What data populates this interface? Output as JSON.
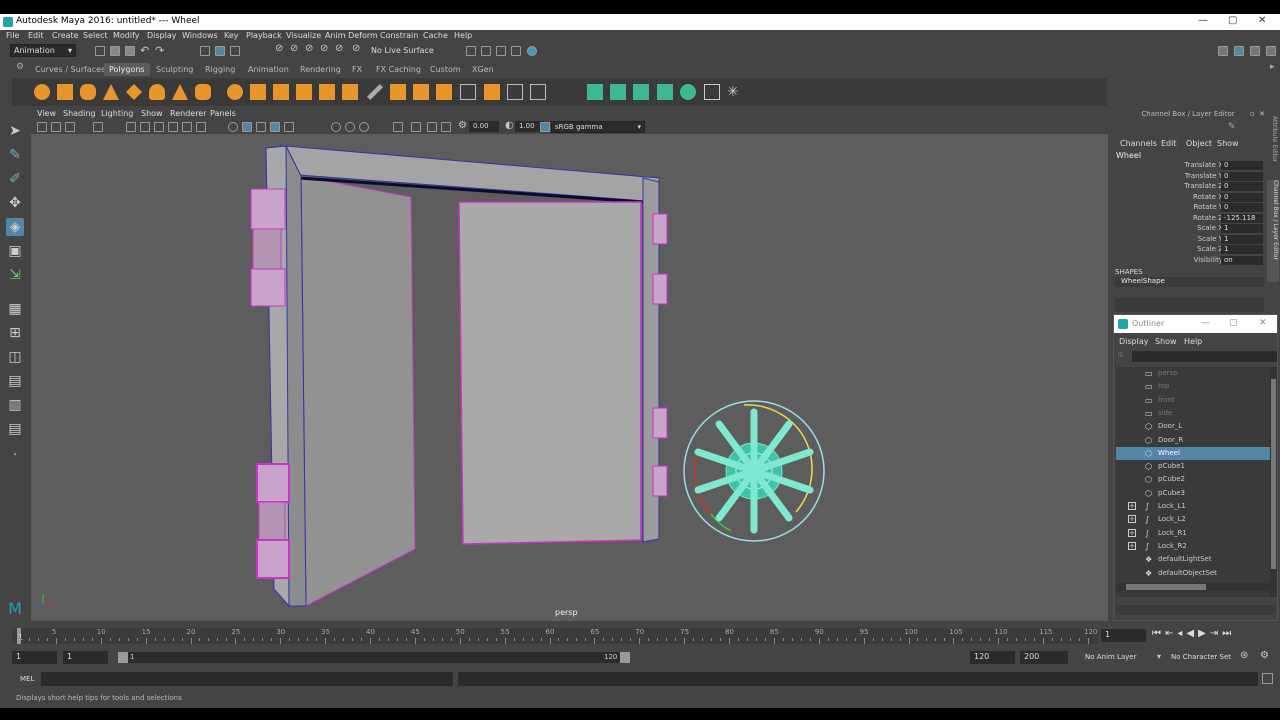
{
  "window": {
    "title": "Autodesk Maya 2016: untitled*  ---  Wheel"
  },
  "menubar": [
    "File",
    "Edit",
    "Create",
    "Select",
    "Modify",
    "Display",
    "Windows",
    "Key",
    "Playback",
    "Visualize",
    "Anim Deform",
    "Constrain",
    "Cache",
    "Help"
  ],
  "statusline": {
    "mode": "Animation",
    "live_surface": "No Live Surface"
  },
  "shelf_tabs": [
    "Curves / Surfaces",
    "Polygons",
    "Sculpting",
    "Rigging",
    "Animation",
    "Rendering",
    "FX",
    "FX Caching",
    "Custom",
    "XGen"
  ],
  "shelf_active": "Polygons",
  "viewport": {
    "menu": [
      "View",
      "Shading",
      "Lighting",
      "Show",
      "Renderer",
      "Panels"
    ],
    "exposure": "0.00",
    "gamma": "1.00",
    "color_space": "sRGB gamma",
    "camera_label": "persp"
  },
  "channel_box": {
    "header": "Channel Box / Layer Editor",
    "menu": [
      "Channels",
      "Edit",
      "Object",
      "Show"
    ],
    "object": "Wheel",
    "attributes": [
      {
        "name": "Translate X",
        "value": "0"
      },
      {
        "name": "Translate Y",
        "value": "0"
      },
      {
        "name": "Translate Z",
        "value": "0"
      },
      {
        "name": "Rotate X",
        "value": "0"
      },
      {
        "name": "Rotate Y",
        "value": "0"
      },
      {
        "name": "Rotate Z",
        "value": "-125.118"
      },
      {
        "name": "Scale X",
        "value": "1"
      },
      {
        "name": "Scale Y",
        "value": "1"
      },
      {
        "name": "Scale Z",
        "value": "1"
      },
      {
        "name": "Visibility",
        "value": "on"
      }
    ],
    "shapes_label": "SHAPES",
    "shape_name": "WheelShape"
  },
  "side_tabs": {
    "attribute_editor": "Attribute Editor",
    "channel_box": "Channel Box / Layer Editor"
  },
  "outliner": {
    "title": "Outliner",
    "menu": [
      "Display",
      "Show",
      "Help"
    ],
    "items": [
      {
        "label": "persp",
        "icon": "camera-icon",
        "dim": true
      },
      {
        "label": "top",
        "icon": "camera-icon",
        "dim": true
      },
      {
        "label": "front",
        "icon": "camera-icon",
        "dim": true
      },
      {
        "label": "side",
        "icon": "camera-icon",
        "dim": true
      },
      {
        "label": "Door_L",
        "icon": "mesh-icon"
      },
      {
        "label": "Door_R",
        "icon": "mesh-icon"
      },
      {
        "label": "Wheel",
        "icon": "mesh-icon",
        "selected": true
      },
      {
        "label": "pCube1",
        "icon": "mesh-icon"
      },
      {
        "label": "pCube2",
        "icon": "mesh-icon"
      },
      {
        "label": "pCube3",
        "icon": "mesh-icon"
      },
      {
        "label": "Lock_L1",
        "icon": "curve-icon",
        "expand": true
      },
      {
        "label": "Lock_L2",
        "icon": "curve-icon",
        "expand": true
      },
      {
        "label": "Lock_R1",
        "icon": "curve-icon",
        "expand": true
      },
      {
        "label": "Lock_R2",
        "icon": "curve-icon",
        "expand": true
      },
      {
        "label": "defaultLightSet",
        "icon": "set-icon"
      },
      {
        "label": "defaultObjectSet",
        "icon": "set-icon"
      }
    ]
  },
  "timeline": {
    "ticks": [
      "5",
      "10",
      "15",
      "20",
      "25",
      "30",
      "35",
      "40",
      "45",
      "50",
      "55",
      "60",
      "65",
      "70",
      "75",
      "80",
      "85",
      "90",
      "95",
      "100",
      "105",
      "110",
      "115",
      "120"
    ],
    "start_marker": "1",
    "current_frame": "1"
  },
  "range": {
    "start": "1",
    "anim_start": "1",
    "slider_start": "1",
    "slider_end": "120",
    "anim_end": "120",
    "end": "200",
    "anim_layer": "No Anim Layer",
    "character_set": "No Character Set"
  },
  "command_line": {
    "label": "MEL"
  },
  "help_line": "Displays short help tips for tools and selections",
  "colors": {
    "accent": "#5285a6",
    "selection": "#d040d0",
    "mesh_green": "#40c0a0"
  }
}
